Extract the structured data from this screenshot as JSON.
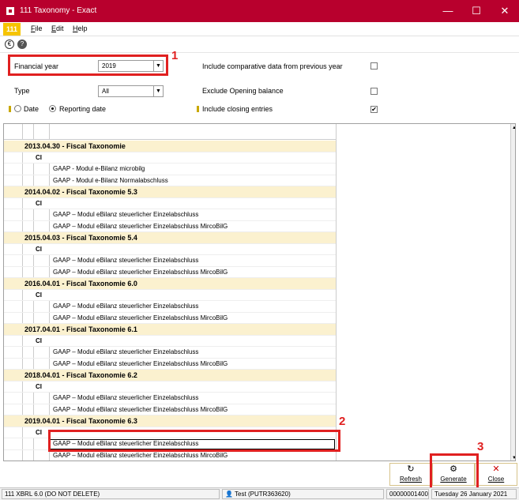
{
  "window": {
    "title": "111 Taxonomy - Exact",
    "minimize": "—",
    "maximize": "☐",
    "close": "✕"
  },
  "menu": {
    "badge": "111",
    "items": [
      {
        "accel": "F",
        "rest": "ile"
      },
      {
        "accel": "E",
        "rest": "dit"
      },
      {
        "accel": "H",
        "rest": "elp"
      }
    ]
  },
  "icons": {
    "euro": "€",
    "help": "?"
  },
  "filters": {
    "financial_year_label": "Financial year",
    "financial_year_value": "2019",
    "type_label": "Type",
    "type_value": "All",
    "include_comparative_label": "Include comparative data from previous year",
    "include_comparative_checked": "",
    "exclude_opening_label": "Exclude Opening balance",
    "exclude_opening_checked": "",
    "date_label": "Date",
    "reporting_date_label": "Reporting date",
    "include_closing_label": "Include closing entries",
    "include_closing_checked": "✔"
  },
  "annotations": {
    "n1": "1",
    "n2": "2",
    "n3": "3"
  },
  "tree": [
    {
      "kind": "grp",
      "text": "2013.04.30 - Fiscal Taxonomie"
    },
    {
      "kind": "ci",
      "text": "CI"
    },
    {
      "kind": "item",
      "text": "GAAP - Modul e-Bilanz microbilg"
    },
    {
      "kind": "item",
      "text": "GAAP - Modul e-Bilanz Normalabschluss"
    },
    {
      "kind": "grp",
      "text": "2014.04.02 - Fiscal Taxonomie 5.3"
    },
    {
      "kind": "ci",
      "text": "CI"
    },
    {
      "kind": "item",
      "text": "GAAP – Modul eBilanz steuerlicher Einzelabschluss"
    },
    {
      "kind": "item",
      "text": "GAAP – Modul eBilanz steuerlicher Einzelabschluss MircoBilG"
    },
    {
      "kind": "grp",
      "text": "2015.04.03 - Fiscal Taxonomie 5.4"
    },
    {
      "kind": "ci",
      "text": "CI"
    },
    {
      "kind": "item",
      "text": "GAAP – Modul eBilanz steuerlicher Einzelabschluss"
    },
    {
      "kind": "item",
      "text": "GAAP – Modul eBilanz steuerlicher Einzelabschluss MircoBilG"
    },
    {
      "kind": "grp",
      "text": "2016.04.01 - Fiscal Taxonomie 6.0"
    },
    {
      "kind": "ci",
      "text": "CI"
    },
    {
      "kind": "item",
      "text": "GAAP – Modul eBilanz steuerlicher Einzelabschluss"
    },
    {
      "kind": "item",
      "text": "GAAP – Modul eBilanz steuerlicher Einzelabschluss MircoBilG"
    },
    {
      "kind": "grp",
      "text": "2017.04.01 - Fiscal Taxonomie 6.1"
    },
    {
      "kind": "ci",
      "text": "CI"
    },
    {
      "kind": "item",
      "text": "GAAP – Modul eBilanz steuerlicher Einzelabschluss"
    },
    {
      "kind": "item",
      "text": "GAAP – Modul eBilanz steuerlicher Einzelabschluss MircoBilG"
    },
    {
      "kind": "grp",
      "text": "2018.04.01 - Fiscal Taxonomie 6.2"
    },
    {
      "kind": "ci",
      "text": "CI"
    },
    {
      "kind": "item",
      "text": "GAAP – Modul eBilanz steuerlicher Einzelabschluss"
    },
    {
      "kind": "item",
      "text": "GAAP – Modul eBilanz steuerlicher Einzelabschluss MircoBilG"
    },
    {
      "kind": "grp",
      "text": "2019.04.01 - Fiscal Taxonomie 6.3"
    },
    {
      "kind": "ci",
      "text": "CI"
    },
    {
      "kind": "item",
      "text": "GAAP – Modul eBilanz steuerlicher Einzelabschluss",
      "selected": true
    },
    {
      "kind": "item",
      "text": "GAAP – Modul eBilanz steuerlicher Einzelabschluss MircoBilG"
    }
  ],
  "buttons": {
    "refresh": {
      "accel": "R",
      "rest": "efresh",
      "glyph": "↻"
    },
    "generate": {
      "accel": "G",
      "rest": "enerate",
      "glyph": "⚙"
    },
    "close": {
      "accel": "C",
      "rest": "lose",
      "glyph": "✕"
    }
  },
  "status": {
    "company": "111 XBRL 6.0 (DO NOT DELETE)",
    "user": "Test (PUTR363620)",
    "user_icon": "👤",
    "code": "00000001400",
    "date": "Tuesday 26 January 2021"
  },
  "colors": {
    "title_bar": "#b8002d",
    "accent_yellow": "#f6c400",
    "annotation_red": "#e02020",
    "group_row": "#fbf1cf"
  }
}
